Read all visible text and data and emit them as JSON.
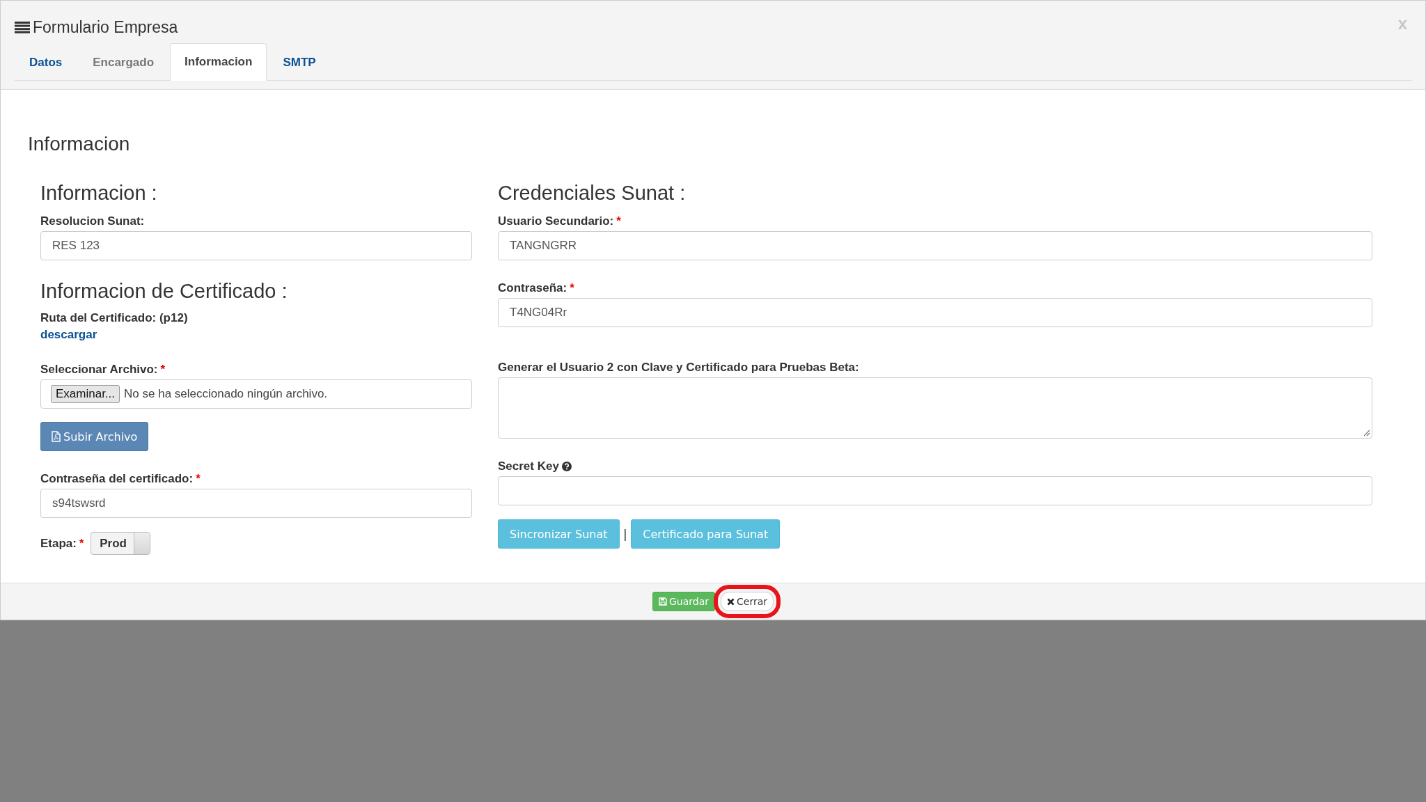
{
  "window": {
    "title": "Formulario Empresa",
    "close": "x"
  },
  "tabs": [
    {
      "label": "Datos",
      "selected": false,
      "disabled": false
    },
    {
      "label": "Encargado",
      "selected": false,
      "disabled": true
    },
    {
      "label": "Informacion",
      "selected": true,
      "disabled": false
    },
    {
      "label": "SMTP",
      "selected": false,
      "disabled": false
    }
  ],
  "required_mark": "*",
  "page_heading": "Informacion",
  "informacion": {
    "heading": "Informacion :",
    "field": {
      "label": "Resolucion Sunat:",
      "required": false,
      "value": "RES 123"
    }
  },
  "certificado": {
    "heading": "Informacion de Certificado :",
    "path_label": "Ruta del Certificado: (p12)",
    "download_link": "descargar",
    "file": {
      "label": "Seleccionar Archivo:",
      "required": true,
      "button": "Examinar...",
      "status": "No se ha seleccionado ningún archivo."
    },
    "upload_button": "Subir Archivo",
    "password": {
      "label": "Contraseña del certificado:",
      "required": true,
      "value": "s94tswsrd"
    },
    "stage": {
      "label": "Etapa:",
      "required": true,
      "toggle": "Prod"
    }
  },
  "credenciales": {
    "heading": "Credenciales Sunat :",
    "fields": [
      {
        "label": "Usuario Secundario:",
        "required": true,
        "kind": "input",
        "value": "TANGNGRR",
        "help": false
      },
      {
        "label": "Contraseña:",
        "required": true,
        "kind": "input",
        "value": "T4NG04Rr",
        "help": false
      },
      {
        "label": "Generar el Usuario 2 con Clave y Certificado para Pruebas Beta:",
        "required": false,
        "kind": "textarea",
        "help": false
      },
      {
        "label": "Secret Key",
        "required": false,
        "kind": "input",
        "help": true
      }
    ],
    "buttons": [
      "Sincronizar Sunat",
      "Certificado para Sunat"
    ],
    "separator": "|"
  },
  "footer": {
    "buttons": [
      {
        "label": "Guardar",
        "kind": "save",
        "highlighted": false
      },
      {
        "label": "Cerrar",
        "kind": "close",
        "highlighted": true
      }
    ]
  }
}
